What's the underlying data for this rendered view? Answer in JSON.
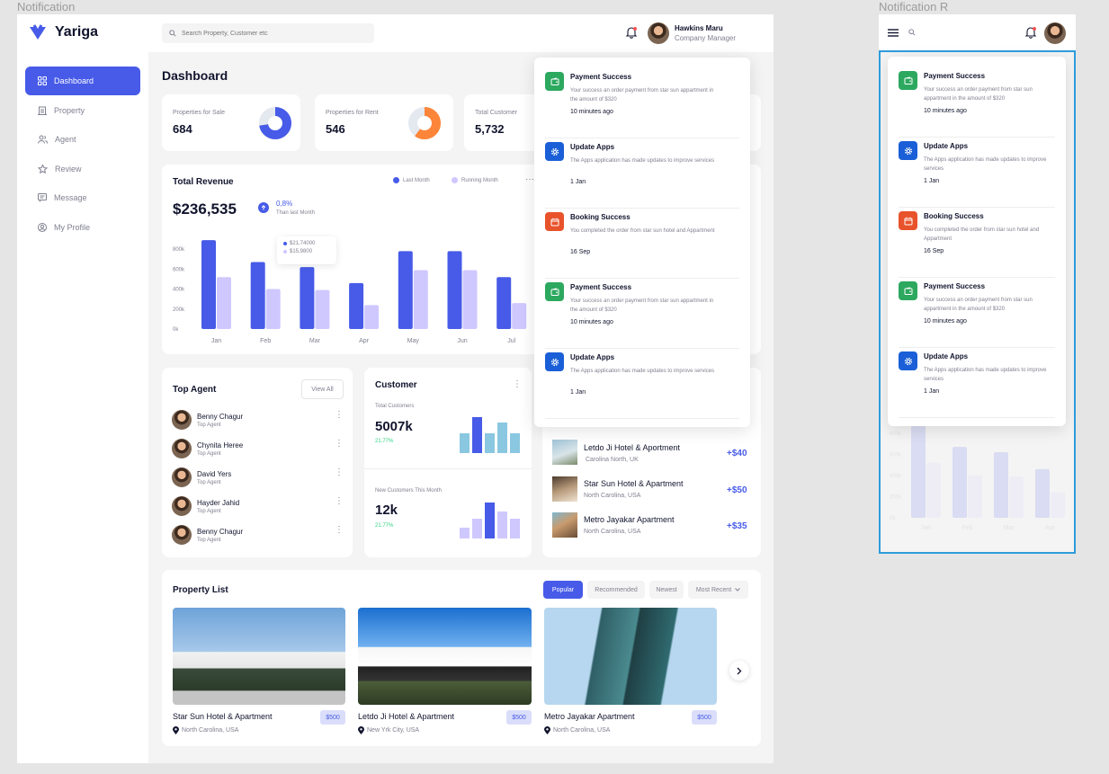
{
  "frames": {
    "main_label": "Notification",
    "right_label": "Notification R"
  },
  "app": {
    "name": "Yariga"
  },
  "search": {
    "placeholder": "Search Property, Customer etc"
  },
  "user": {
    "name": "Hawkins Maru",
    "role": "Company Manager"
  },
  "sidebar": {
    "items": [
      {
        "label": "Dashboard",
        "icon": "grid-icon",
        "active": true
      },
      {
        "label": "Property",
        "icon": "building-icon"
      },
      {
        "label": "Agent",
        "icon": "users-icon"
      },
      {
        "label": "Review",
        "icon": "star-icon"
      },
      {
        "label": "Message",
        "icon": "message-icon"
      },
      {
        "label": "My Profile",
        "icon": "profile-icon"
      }
    ]
  },
  "page": {
    "title": "Dashboard"
  },
  "stats": [
    {
      "label": "Properties for Sale",
      "value": "684",
      "ring": 0.72,
      "color": "#475be8"
    },
    {
      "label": "Properties for Rent",
      "value": "546",
      "ring": 0.6,
      "color": "#fd8539"
    },
    {
      "label": "Total Customer",
      "value": "5,732"
    }
  ],
  "revenue": {
    "title": "Total Revenue",
    "amount": "$236,535",
    "change": "0,8%",
    "change_note": "Than last Month",
    "legend": [
      "Last Month",
      "Running Month"
    ],
    "tooltip": [
      "$21,74000",
      "$15,9800"
    ]
  },
  "agents": {
    "title": "Top Agent",
    "view_all": "View All",
    "items": [
      {
        "name": "Benny Chagur",
        "role": "Top Agent"
      },
      {
        "name": "Chynita Heree",
        "role": "Top Agent"
      },
      {
        "name": "David Yers",
        "role": "Top Agent"
      },
      {
        "name": "Hayder Jahid",
        "role": "Top Agent"
      },
      {
        "name": "Benny Chagur",
        "role": "Top Agent"
      }
    ]
  },
  "customer": {
    "title": "Customer",
    "total_label": "Total Customers",
    "total_value": "5007k",
    "total_change": "21.77%",
    "new_label": "New Customers This Month",
    "new_value": "12k",
    "new_change": "21.77%"
  },
  "sales": [
    {
      "name": "Letdo Ji Hotel & Aportment",
      "location": "Carolina North, UK",
      "amount": "+$40"
    },
    {
      "name": "Star Sun Hotel & Apartment",
      "location": "North Carolina, USA",
      "amount": "+$50"
    },
    {
      "name": "Metro Jayakar Apartment",
      "location": "North Carolina, USA",
      "amount": "+$35"
    }
  ],
  "property_list": {
    "title": "Property List",
    "filters": [
      "Popular",
      "Recommended",
      "Newest",
      "Most Recent"
    ],
    "items": [
      {
        "name": "Star Sun Hotel & Apartment",
        "location": "North Carolina, USA",
        "price": "$500"
      },
      {
        "name": "Letdo Ji Hotel & Apartment",
        "location": "New Yrk City, USA",
        "price": "$500"
      },
      {
        "name": "Metro Jayakar Apartment",
        "location": "North Carolina, USA",
        "price": "$500"
      }
    ]
  },
  "notifications": [
    {
      "title": "Payment Success",
      "message": "Your success an order payment from star sun appartment in the amount of $320",
      "time": "10 minutes ago",
      "color": "#2ca85f",
      "icon": "wallet-icon"
    },
    {
      "title": "Update Apps",
      "message": "The Apps application has made updates to improve services",
      "time": "1 Jan",
      "color": "#1a5fd7",
      "icon": "gear-icon"
    },
    {
      "title": "Booking Success",
      "message": "You completed the order from star sun hotel and Appartment",
      "time": "16 Sep",
      "color": "#e8532b",
      "icon": "calendar-icon"
    },
    {
      "title": "Payment Success",
      "message": "Your success an order payment from star sun appartment in the amount of $320",
      "time": "10 minutes ago",
      "color": "#2ca85f",
      "icon": "wallet-icon"
    },
    {
      "title": "Update Apps",
      "message": "The Apps application has made updates to improve services",
      "time": "1 Jan",
      "color": "#1a5fd7",
      "icon": "gear-icon"
    }
  ],
  "chart_data": {
    "type": "bar",
    "categories": [
      "Jan",
      "Feb",
      "Mar",
      "Apr",
      "May",
      "Jun",
      "Jul"
    ],
    "series": [
      {
        "name": "Last Month",
        "values": [
          890,
          670,
          620,
          460,
          780,
          780,
          520
        ],
        "color": "#475be8"
      },
      {
        "name": "Running Month",
        "values": [
          520,
          400,
          390,
          240,
          590,
          590,
          260
        ],
        "color": "#cfc8ff"
      }
    ],
    "yticks": [
      "800k",
      "600k",
      "400k",
      "200k",
      "0k"
    ],
    "ylim": [
      0,
      900
    ]
  }
}
